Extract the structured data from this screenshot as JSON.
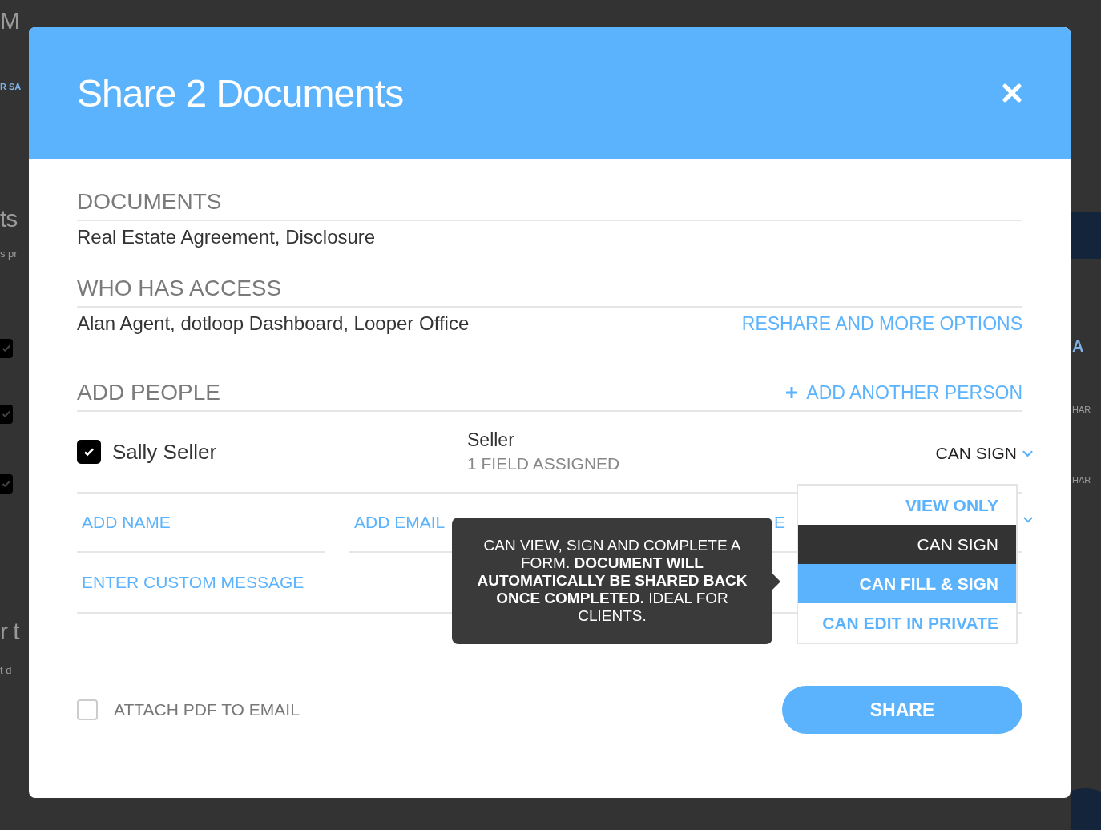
{
  "background": {
    "left": [
      {
        "kind": "title",
        "text": "M"
      },
      {
        "kind": "link",
        "text": "R SA"
      },
      {
        "kind": "title",
        "text": "ts"
      },
      {
        "kind": "sub",
        "text": "s pr"
      },
      {
        "kind": "checkbox",
        "checked": true
      },
      {
        "kind": "checkbox",
        "checked": true
      },
      {
        "kind": "checkbox",
        "checked": true
      },
      {
        "kind": "title",
        "text": "r t"
      },
      {
        "kind": "sub",
        "text": "t d"
      }
    ],
    "right": [
      {
        "kind": "bar"
      },
      {
        "kind": "link",
        "text": "A"
      },
      {
        "kind": "label",
        "text": "HAR"
      },
      {
        "kind": "label",
        "text": "HAR"
      }
    ]
  },
  "dialog": {
    "title": "Share 2 Documents",
    "documents": {
      "heading": "DOCUMENTS",
      "value": "Real Estate Agreement, Disclosure"
    },
    "access": {
      "heading": "WHO HAS ACCESS",
      "value": "Alan Agent, dotloop Dashboard, Looper Office",
      "link": "RESHARE AND MORE OPTIONS"
    },
    "add_people": {
      "heading": "ADD PEOPLE",
      "link": "ADD ANOTHER PERSON",
      "person": {
        "name": "Sally Seller",
        "checked": true,
        "role": "Seller",
        "fields": "1 FIELD ASSIGNED",
        "permission": "CAN SIGN"
      },
      "name_placeholder": "ADD NAME",
      "email_placeholder": "ADD EMAIL",
      "role_field": "E",
      "message_placeholder": "ENTER CUSTOM MESSAGE"
    },
    "tooltip": "CAN VIEW, SIGN AND COMPLETE A FORM. **DOCUMENT WILL AUTOMATICALLY BE SHARED BACK ONCE COMPLETED.** IDEAL FOR CLIENTS.",
    "menu": [
      {
        "label": "VIEW ONLY",
        "selected": false,
        "hovered": false
      },
      {
        "label": "CAN SIGN",
        "selected": false,
        "hovered": true
      },
      {
        "label": "CAN FILL & SIGN",
        "selected": true,
        "hovered": false
      },
      {
        "label": "CAN EDIT IN PRIVATE",
        "selected": false,
        "hovered": false
      }
    ],
    "attach": {
      "label": "ATTACH PDF TO EMAIL",
      "checked": false
    },
    "share": "SHARE"
  }
}
